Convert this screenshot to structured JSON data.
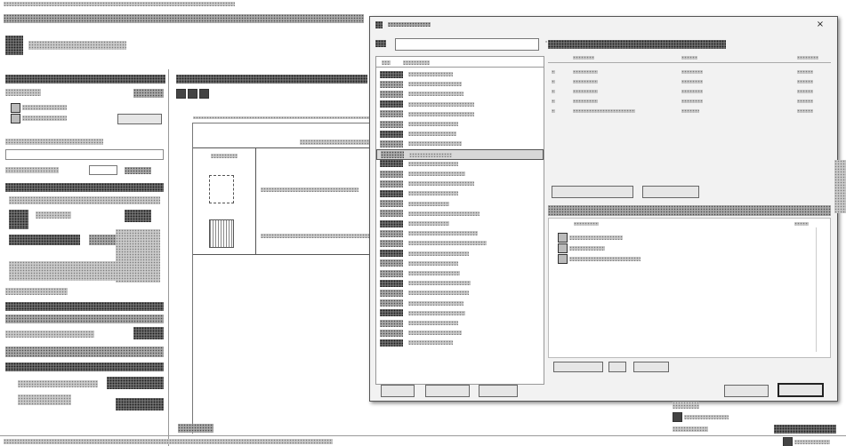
{
  "menu": {
    "items": [
      "",
      "",
      "",
      "",
      "",
      "",
      "",
      ""
    ]
  },
  "left_panel": {
    "title": "",
    "sections": [
      "",
      "",
      "",
      "",
      ""
    ],
    "fields": [
      "",
      "",
      "",
      ""
    ]
  },
  "document": {
    "tabs": [
      "",
      "",
      ""
    ],
    "table_header": [
      "",
      ""
    ],
    "rows": [
      "",
      ""
    ]
  },
  "dialog": {
    "title": "",
    "search_placeholder": "",
    "list_header": "",
    "items": [
      "",
      "",
      "",
      "",
      "",
      "",
      "",
      "",
      "",
      "",
      "",
      "",
      "",
      "",
      "",
      "",
      "",
      "",
      "",
      "",
      "",
      "",
      "",
      "",
      "",
      "",
      "",
      ""
    ],
    "group_label": "",
    "last_item": "",
    "right_top_header": "",
    "columns": [
      "",
      "",
      "",
      ""
    ],
    "table_rows": [
      [
        "",
        "",
        "",
        ""
      ],
      [
        "",
        "",
        "",
        ""
      ],
      [
        "",
        "",
        "",
        ""
      ],
      [
        "",
        "",
        "",
        ""
      ],
      [
        "",
        "",
        "",
        ""
      ]
    ],
    "right_bottom_header": "",
    "tree_items": [
      "",
      "",
      "",
      ""
    ],
    "buttons": {
      "ok": "",
      "cancel": "",
      "left1": "",
      "left2": "",
      "left3": "",
      "mid1": "",
      "mid2": "",
      "mid3": ""
    }
  },
  "status_bar": {
    "text": "",
    "right": ""
  }
}
